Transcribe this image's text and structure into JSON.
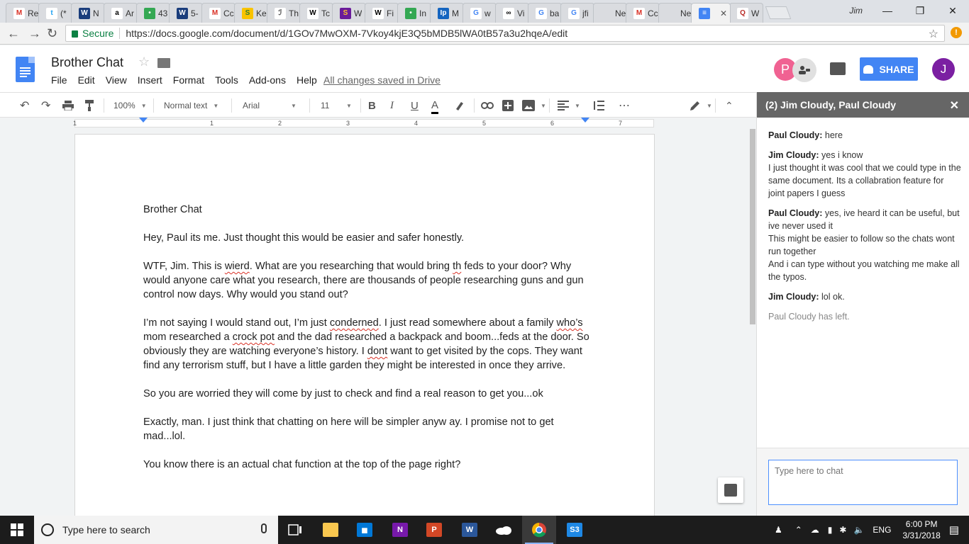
{
  "browser": {
    "tabs": [
      {
        "title": "Re",
        "color": "#ffffff",
        "glyph": "M",
        "glyphColor": "#d93025"
      },
      {
        "title": "(*",
        "color": "#ffffff",
        "glyph": "t",
        "glyphColor": "#1da1f2"
      },
      {
        "title": "N",
        "color": "#1a3d7c",
        "glyph": "W",
        "glyphColor": "#ffffff"
      },
      {
        "title": "Ar",
        "color": "#ffffff",
        "glyph": "a",
        "glyphColor": "#000000"
      },
      {
        "title": "43",
        "color": "#34a853",
        "glyph": "•",
        "glyphColor": "#ffffff"
      },
      {
        "title": "5-",
        "color": "#1a3d7c",
        "glyph": "W",
        "glyphColor": "#ffffff"
      },
      {
        "title": "Cc",
        "color": "#ffffff",
        "glyph": "M",
        "glyphColor": "#d93025"
      },
      {
        "title": "Ke",
        "color": "#f9c300",
        "glyph": "S",
        "glyphColor": "#2e7d32"
      },
      {
        "title": "Th",
        "color": "#ffffff",
        "glyph": "ℐ",
        "glyphColor": "#333333"
      },
      {
        "title": "Tc",
        "color": "#ffffff",
        "glyph": "W",
        "glyphColor": "#000000"
      },
      {
        "title": "W",
        "color": "#6a1b9a",
        "glyph": "S",
        "glyphColor": "#fbc02d"
      },
      {
        "title": "Fi",
        "color": "#ffffff",
        "glyph": "W",
        "glyphColor": "#000000"
      },
      {
        "title": "In",
        "color": "#34a853",
        "glyph": "•",
        "glyphColor": "#ffffff"
      },
      {
        "title": "M",
        "color": "#1565c0",
        "glyph": "Ip",
        "glyphColor": "#ffffff"
      },
      {
        "title": "w",
        "color": "#ffffff",
        "glyph": "G",
        "glyphColor": "#4285f4"
      },
      {
        "title": "Vi",
        "color": "#ffffff",
        "glyph": "∞",
        "glyphColor": "#000000"
      },
      {
        "title": "ba",
        "color": "#ffffff",
        "glyph": "G",
        "glyphColor": "#4285f4"
      },
      {
        "title": "jfi",
        "color": "#ffffff",
        "glyph": "G",
        "glyphColor": "#4285f4"
      },
      {
        "title": "New T",
        "color": "#dadce0",
        "glyph": "",
        "glyphColor": "#000000"
      },
      {
        "title": "Cc",
        "color": "#ffffff",
        "glyph": "M",
        "glyphColor": "#d93025"
      },
      {
        "title": "New T",
        "color": "#dadce0",
        "glyph": "",
        "glyphColor": "#000000"
      },
      {
        "title": "",
        "color": "#4285f4",
        "glyph": "≡",
        "glyphColor": "#ffffff",
        "active": true
      },
      {
        "title": "W",
        "color": "#ffffff",
        "glyph": "Q",
        "glyphColor": "#b92b27"
      }
    ],
    "user_label": "Jim",
    "secure_label": "Secure",
    "url": "https://docs.google.com/document/d/1GOv7MwOXM-7Vkoy4kjE3Q5bMDB5lWA0tB57a3u2hqeA/edit"
  },
  "docs": {
    "title": "Brother Chat",
    "menus": [
      "File",
      "Edit",
      "View",
      "Insert",
      "Format",
      "Tools",
      "Add-ons",
      "Help"
    ],
    "saved_status": "All changes saved in Drive",
    "avatar_p": "P",
    "avatar_j": "J",
    "share_label": "SHARE"
  },
  "toolbar": {
    "zoom": "100%",
    "style": "Normal text",
    "font": "Arial",
    "size": "11",
    "bold": "B",
    "italic": "I",
    "underline": "U",
    "text_color": "A"
  },
  "ruler": {
    "numbers": [
      "1",
      "1",
      "2",
      "3",
      "4",
      "5",
      "6",
      "7"
    ]
  },
  "document": {
    "paragraphs": [
      [
        {
          "t": "Brother Chat"
        }
      ],
      [
        {
          "t": "Hey, Paul its me. Just thought this would be easier and safer honestly."
        }
      ],
      [
        {
          "t": "WTF, Jim. This is "
        },
        {
          "t": "wierd",
          "s": true
        },
        {
          "t": ". What are you researching that would bring "
        },
        {
          "t": "th",
          "s": true
        },
        {
          "t": " feds to your door? Why would anyone care what you research, there are thousands of people researching guns and gun control now days. Why would you stand out?"
        }
      ],
      [
        {
          "t": "I’m not saying I would stand out, I’m just "
        },
        {
          "t": "conderned",
          "s": true
        },
        {
          "t": ". I just read somewhere about a family "
        },
        {
          "t": "who’s",
          "s": true
        },
        {
          "t": " mom researched a "
        },
        {
          "t": "crock pot",
          "s": true
        },
        {
          "t": " and the dad researched a backpack and boom...feds at the door. So obviously they are watching everyone’s history. I "
        },
        {
          "t": "dont",
          "s": true
        },
        {
          "t": " want to get visited by the cops. They want find any terrorism stuff, but I have a little garden they might be interested in once they arrive."
        }
      ],
      [
        {
          "t": "So you are worried they will come by just to check and find a real reason to get you...ok"
        }
      ],
      [
        {
          "t": "Exactly, man. I just think that chatting on here will be simpler anyw ay. I promise not to get mad...lol."
        }
      ],
      [
        {
          "t": "You know there is an actual chat function at the top of the page right?"
        }
      ]
    ]
  },
  "chat": {
    "header": "(2) Jim Cloudy, Paul Cloudy",
    "messages": [
      {
        "who": "Paul Cloudy:",
        "lines": [
          "here"
        ]
      },
      {
        "who": "Jim Cloudy:",
        "lines": [
          "yes i know",
          "I just thought it was cool that we could type in the same document. Its a collabration feature for joint papers I guess"
        ]
      },
      {
        "who": "Paul Cloudy:",
        "lines": [
          "yes, ive heard it can be useful, but ive never used it",
          "This might be easier to follow so the chats wont run together",
          "And i can type without you watching me make all the typos."
        ]
      },
      {
        "who": "Jim Cloudy:",
        "lines": [
          "lol ok."
        ]
      },
      {
        "system": "Paul Cloudy has left."
      }
    ],
    "input_placeholder": "Type here to chat"
  },
  "taskbar": {
    "search_placeholder": "Type here to search",
    "language": "ENG",
    "time": "6:00 PM",
    "date": "3/31/2018"
  }
}
